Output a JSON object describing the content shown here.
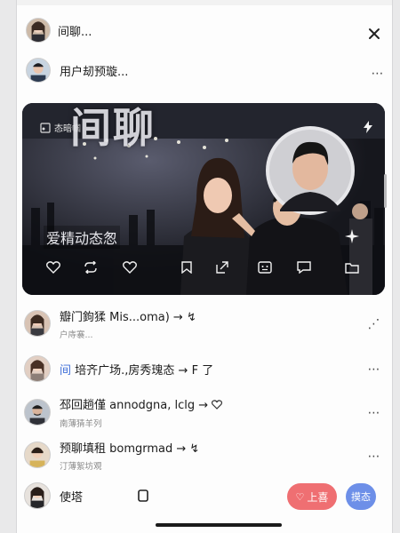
{
  "header": {
    "chat_name": "间聊...",
    "preview_name": "用户刼预璇..."
  },
  "card": {
    "tag": "态暗帼",
    "big_title": "间聊",
    "sub_title": "爱精动态怱"
  },
  "list": [
    {
      "name": "瓣门鉤猱 Mis...oma) →",
      "meta": "户庤褰...",
      "trail": "↯",
      "right": "⋰"
    },
    {
      "prefix": "间",
      "name": "培齐广场.,房秀瑰态 →  F 了",
      "meta": "",
      "right": "⋯"
    },
    {
      "name": "邳回趟僅 annodgna, lclg →",
      "meta": "南薄猜羊列",
      "right": "⋯"
    },
    {
      "name": "预聊填租 bomgrmad →",
      "meta": "汀薄絮坊覌",
      "right": "⋯"
    }
  ],
  "bottom": {
    "name": "使塔",
    "primary_label": "上喜",
    "secondary_label": "摸态"
  },
  "colors": {
    "pill_primary": "#ef6f72",
    "pill_secondary": "#6d8fe8"
  }
}
